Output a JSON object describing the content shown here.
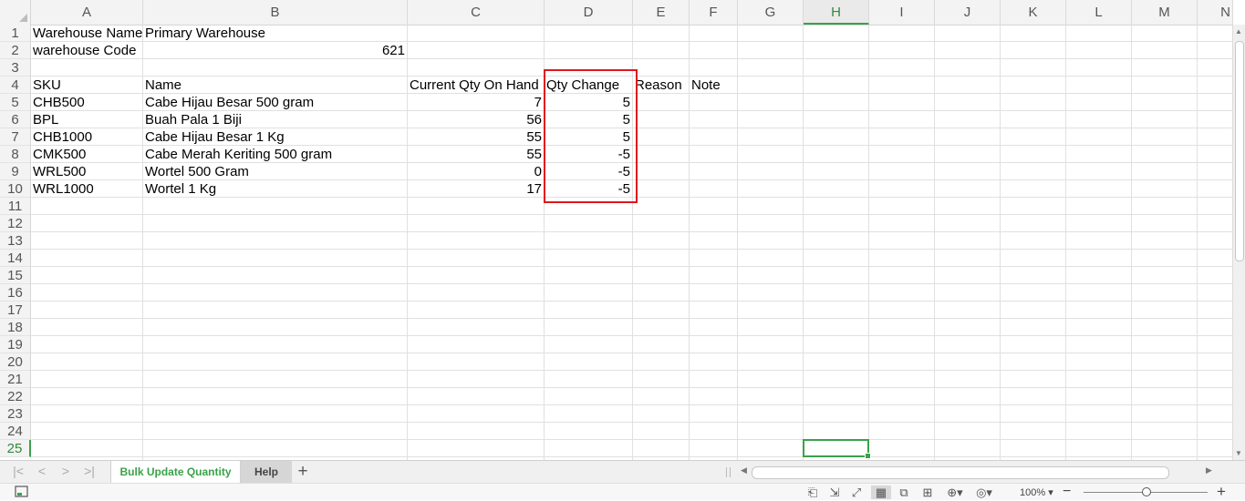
{
  "columns": [
    "A",
    "B",
    "C",
    "D",
    "E",
    "F",
    "G",
    "H",
    "I",
    "J",
    "K",
    "L",
    "M",
    "N"
  ],
  "selected_column": "H",
  "rows": [
    "1",
    "2",
    "3",
    "4",
    "5",
    "6",
    "7",
    "8",
    "9",
    "10",
    "11",
    "12",
    "13",
    "14",
    "15",
    "16",
    "17",
    "18",
    "19",
    "20",
    "21",
    "22",
    "23",
    "24",
    "25"
  ],
  "selected_row": "25",
  "cells": {
    "warehouse_name_label": "Warehouse Name",
    "warehouse_name_value": "Primary Warehouse",
    "warehouse_code_label": "warehouse Code",
    "warehouse_code_value": "621",
    "headers": {
      "sku": "SKU",
      "name": "Name",
      "current_qty": "Current Qty On Hand",
      "qty_change": "Qty Change",
      "reason": "Reason",
      "note": "Note"
    },
    "items": [
      {
        "sku": "CHB500",
        "name": "Cabe Hijau Besar 500 gram",
        "qty": "7",
        "change": "5"
      },
      {
        "sku": "BPL",
        "name": "Buah Pala 1 Biji",
        "qty": "56",
        "change": "5"
      },
      {
        "sku": "CHB1000",
        "name": "Cabe Hijau Besar 1 Kg",
        "qty": "55",
        "change": "5"
      },
      {
        "sku": "CMK500",
        "name": "Cabe Merah Keriting 500 gram",
        "qty": "55",
        "change": "-5"
      },
      {
        "sku": "WRL500",
        "name": "Wortel 500 Gram",
        "qty": "0",
        "change": "-5"
      },
      {
        "sku": "WRL1000",
        "name": "Wortel 1 Kg",
        "qty": "17",
        "change": "-5"
      }
    ]
  },
  "sheet_tabs": {
    "active": "Bulk Update Quantity",
    "other": "Help",
    "add": "+"
  },
  "status": {
    "zoom": "100%",
    "zoom_level_percent": 100
  },
  "colors": {
    "accent": "#3aa14a",
    "highlight": "#e0161e"
  }
}
